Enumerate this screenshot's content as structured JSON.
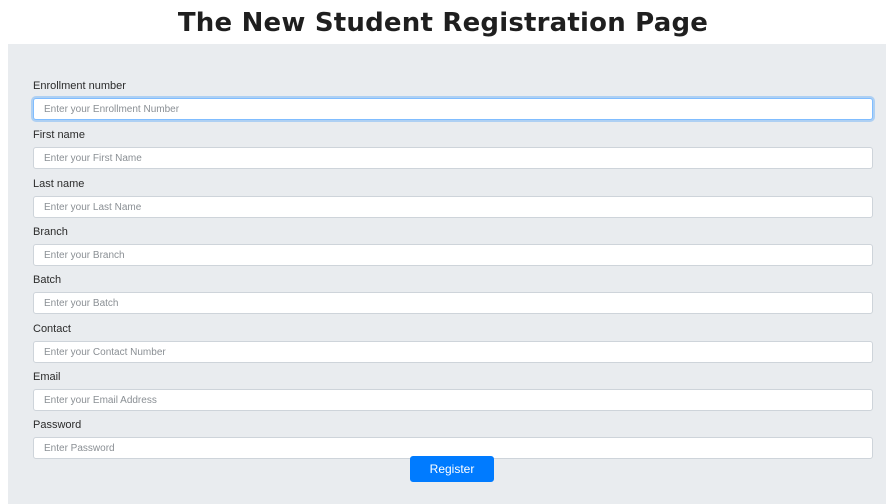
{
  "page": {
    "title": "The New Student Registration Page"
  },
  "form": {
    "fields": [
      {
        "label": "Enrollment number",
        "placeholder": "Enter your Enrollment Number",
        "value": ""
      },
      {
        "label": "First name",
        "placeholder": "Enter your First Name",
        "value": ""
      },
      {
        "label": "Last name",
        "placeholder": "Enter your Last Name",
        "value": ""
      },
      {
        "label": "Branch",
        "placeholder": "Enter your Branch",
        "value": ""
      },
      {
        "label": "Batch",
        "placeholder": "Enter your Batch",
        "value": ""
      },
      {
        "label": "Contact",
        "placeholder": "Enter your Contact Number",
        "value": ""
      },
      {
        "label": "Email",
        "placeholder": "Enter your Email Address",
        "value": ""
      },
      {
        "label": "Password",
        "placeholder": "Enter Password",
        "value": ""
      }
    ],
    "submit_label": "Register"
  },
  "colors": {
    "panel_background": "#e9ecef",
    "accent": "#007bff",
    "focus_border": "#80bdff"
  }
}
